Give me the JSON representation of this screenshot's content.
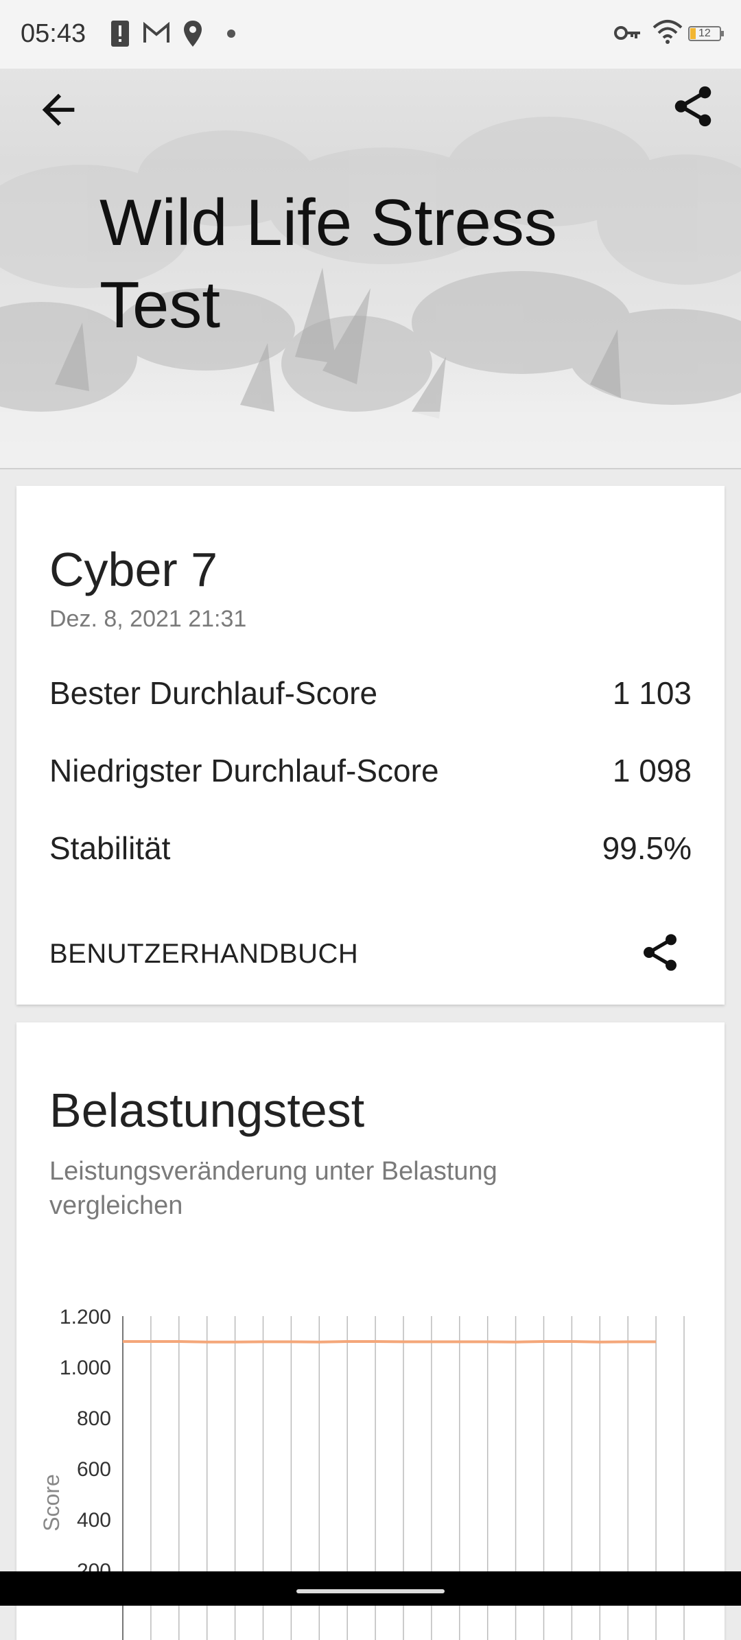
{
  "status_bar": {
    "time": "05:43",
    "battery": "12",
    "icons": [
      "alert-icon",
      "gmail-icon",
      "location-icon",
      "dot-icon",
      "key-icon",
      "wifi-icon",
      "battery-icon"
    ]
  },
  "header": {
    "title": "Wild Life Stress Test",
    "back_icon": "arrow-left-icon",
    "share_icon": "share-icon"
  },
  "result_card": {
    "device": "Cyber 7",
    "date": "Dez. 8, 2021 21:31",
    "rows": [
      {
        "label": "Bester Durchlauf-Score",
        "value": "1 103"
      },
      {
        "label": "Niedrigster Durchlauf-Score",
        "value": "1 098"
      },
      {
        "label": "Stabilität",
        "value": "99.5%"
      }
    ],
    "manual_label": "BENUTZERHANDBUCH"
  },
  "stress_card": {
    "title": "Belastungstest",
    "subtitle": "Leistungsveränderung unter Belastung vergleichen"
  },
  "chart_data": {
    "type": "line",
    "ylabel": "Score",
    "y_ticks": [
      "1.200",
      "1.000",
      "800",
      "600",
      "400",
      "200"
    ],
    "ylim": [
      0,
      1200
    ],
    "grid": true,
    "line_color": "#f4a77a",
    "series": [
      {
        "values": [
          1100,
          1100,
          1100,
          1098,
          1098,
          1099,
          1099,
          1098,
          1100,
          1100,
          1099,
          1099,
          1099,
          1099,
          1098,
          1100,
          1100,
          1098,
          1099,
          1099
        ]
      }
    ]
  }
}
